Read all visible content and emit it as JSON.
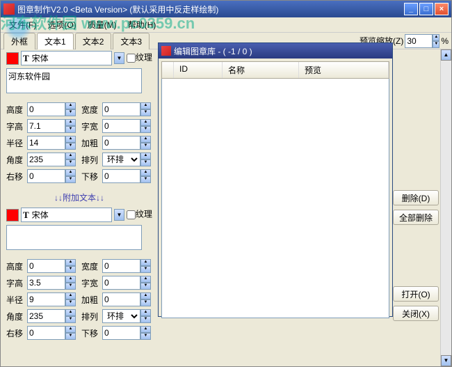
{
  "main_window": {
    "title": "图章制作V2.0 <Beta Version> (默认采用中反走样绘制)"
  },
  "menu": {
    "file": "文件(F)",
    "options": "选项(O)",
    "quality": "质量(M)",
    "help": "帮助(H)"
  },
  "tabs": {
    "outer": "外框",
    "text1": "文本1",
    "text2": "文本2",
    "text3": "文本3"
  },
  "preview_label": "预览",
  "zoom": {
    "label": "缩放(Z)",
    "value": "30",
    "unit": "%"
  },
  "section1": {
    "font": "宋体",
    "pattern_label": "纹理",
    "text_value": "河东软件园",
    "params": {
      "height_label": "高度",
      "height": "0",
      "width_label": "宽度",
      "width": "0",
      "char_h_label": "字高",
      "char_h": "7.1",
      "char_w_label": "字宽",
      "char_w": "0",
      "radius_label": "半径",
      "radius": "14",
      "bold_label": "加粗",
      "bold": "0",
      "angle_label": "角度",
      "angle": "235",
      "arrange_label": "排列",
      "arrange": "环排",
      "xoff_label": "右移",
      "xoff": "0",
      "yoff_label": "下移",
      "yoff": "0"
    }
  },
  "additional_label": "↓↓附加文本↓↓",
  "section2": {
    "font": "宋体",
    "pattern_label": "纹理",
    "params": {
      "height_label": "高度",
      "height": "0",
      "width_label": "宽度",
      "width": "0",
      "char_h_label": "字高",
      "char_h": "3.5",
      "char_w_label": "字宽",
      "char_w": "0",
      "radius_label": "半径",
      "radius": "9",
      "bold_label": "加粗",
      "bold": "0",
      "angle_label": "角度",
      "angle": "235",
      "arrange_label": "排列",
      "arrange": "环排",
      "xoff_label": "右移",
      "xoff": "0",
      "yoff_label": "下移",
      "yoff": "0"
    }
  },
  "dialog": {
    "title": "编辑图章库  -  ( -1 / 0 )",
    "columns": {
      "id": "ID",
      "name": "名称",
      "preview": "预览"
    }
  },
  "buttons": {
    "delete": "删除(D)",
    "delete_all": "全部删除",
    "open": "打开(O)",
    "close": "关闭(X)"
  },
  "watermark": "河东软件园  www.pc0359.cn"
}
